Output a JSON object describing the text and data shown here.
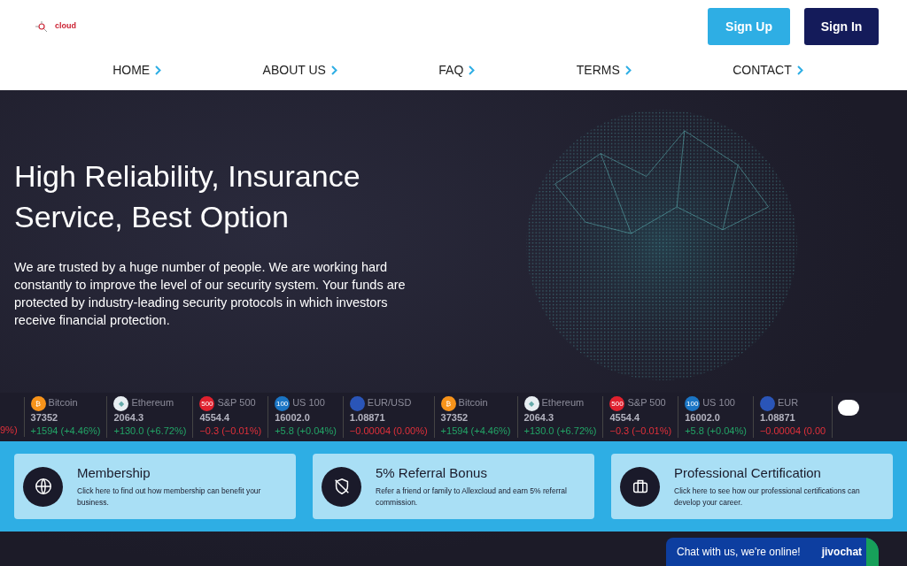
{
  "header": {
    "logo_text": "cloud",
    "buttons": [
      {
        "label": "Sign Up",
        "kind": "primary"
      },
      {
        "label": "Sign In",
        "kind": "dark"
      }
    ]
  },
  "nav": [
    "HOME",
    "ABOUT US",
    "FAQ",
    "TERMS",
    "CONTACT"
  ],
  "hero": {
    "title": "High Reliability, Insurance Service, Best Option",
    "text": "We are trusted by a huge number of people. We are working hard constantly to improve the level of our security system. Your funds are protected by industry-leading security protocols in which investors receive financial protection."
  },
  "ticker": [
    {
      "kind": "fragment",
      "change": "9%)",
      "rising": false
    },
    {
      "kind": "crypto",
      "name": "Bitcoin",
      "value": "37352",
      "change": "+1594 (+4.46%)",
      "rising": true,
      "color": "#f7931a",
      "badge": "₿"
    },
    {
      "kind": "crypto",
      "name": "Ethereum",
      "value": "2064.3",
      "change": "+130.0 (+6.72%)",
      "rising": true,
      "color": "#e8eef2",
      "badge": "◆"
    },
    {
      "kind": "index",
      "name": "S&P 500",
      "value": "4554.4",
      "change": "−0.3 (−0.01%)",
      "rising": false,
      "color": "#e0212e",
      "badge": "500"
    },
    {
      "kind": "index",
      "name": "US 100",
      "value": "16002.0",
      "change": "+5.8 (+0.04%)",
      "rising": true,
      "color": "#1a75c4",
      "badge": "100"
    },
    {
      "kind": "forex",
      "name": "EUR/USD",
      "value": "1.08871",
      "change": "−0.00004 (0.00%)",
      "rising": false,
      "color": "#2a55b8"
    },
    {
      "kind": "crypto",
      "name": "Bitcoin",
      "value": "37352",
      "change": "+1594 (+4.46%)",
      "rising": true,
      "color": "#f7931a",
      "badge": "₿"
    },
    {
      "kind": "crypto",
      "name": "Ethereum",
      "value": "2064.3",
      "change": "+130.0 (+6.72%)",
      "rising": true,
      "color": "#e8eef2",
      "badge": "◆"
    },
    {
      "kind": "index",
      "name": "S&P 500",
      "value": "4554.4",
      "change": "−0.3 (−0.01%)",
      "rising": false,
      "color": "#e0212e",
      "badge": "500"
    },
    {
      "kind": "index",
      "name": "US 100",
      "value": "16002.0",
      "change": "+5.8 (+0.04%)",
      "rising": true,
      "color": "#1a75c4",
      "badge": "100"
    },
    {
      "kind": "forex",
      "name": "EUR",
      "value": "1.08871",
      "change": "−0.00004 (0.00",
      "rising": false,
      "color": "#2a55b8"
    }
  ],
  "features": [
    {
      "title": "Membership",
      "text": "Click here to find out how membership can benefit your business."
    },
    {
      "title": "5% Referral Bonus",
      "text": "Refer a friend or family to Allexcloud and earn 5% referral commission."
    },
    {
      "title": "Professional Certification",
      "text": "Click here to see how our professional certifications can develop your career."
    }
  ],
  "chat": {
    "text": "Chat with us, we're online!",
    "brand": "jivochat"
  }
}
